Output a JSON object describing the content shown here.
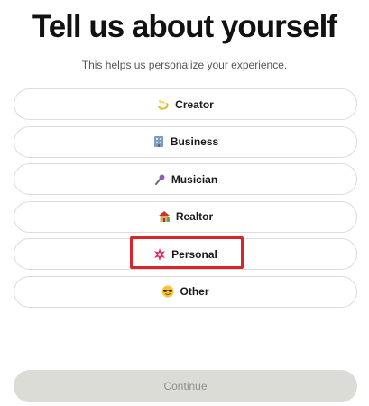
{
  "header": {
    "title": "Tell us about yourself",
    "subtitle": "This helps us personalize your experience."
  },
  "options": [
    {
      "label": "Creator",
      "icon": "sparkle-swirl-icon"
    },
    {
      "label": "Business",
      "icon": "office-building-icon"
    },
    {
      "label": "Musician",
      "icon": "microphone-icon"
    },
    {
      "label": "Realtor",
      "icon": "house-icon"
    },
    {
      "label": "Personal",
      "icon": "starburst-icon",
      "highlighted": true
    },
    {
      "label": "Other",
      "icon": "sunglasses-face-icon"
    }
  ],
  "footer": {
    "continue_label": "Continue",
    "continue_enabled": false
  },
  "colors": {
    "highlight": "#d9252a",
    "option_border": "#dcdcdc",
    "continue_bg": "#dcdcd6",
    "continue_text": "#8d8d8d"
  }
}
